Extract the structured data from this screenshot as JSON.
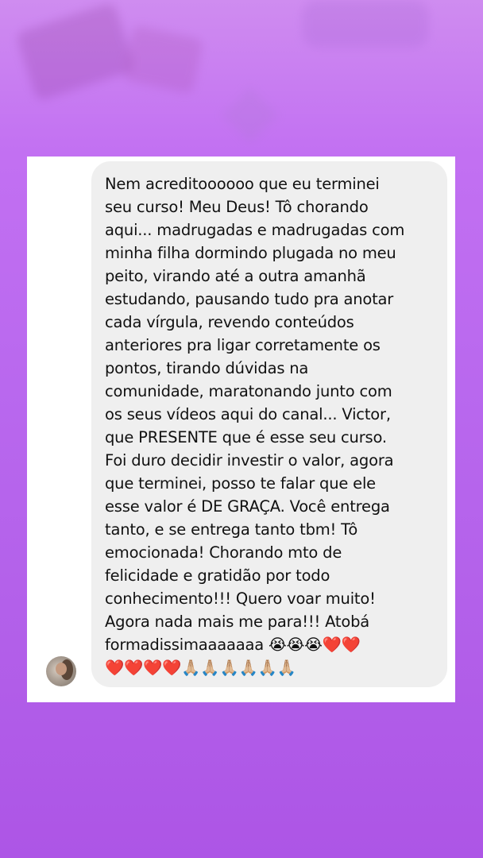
{
  "chat": {
    "message_text": "Nem acreditoooooo que eu terminei\nseu curso! Meu Deus! Tô chorando\naqui... madrugadas e madrugadas com\nminha filha dormindo plugada no meu\npeito, virando até a outra amanhã\nestudando, pausando tudo pra anotar\ncada vírgula, revendo conteúdos\nanteriores pra ligar corretamente os\npontos, tirando dúvidas na\ncomunidade, maratonando junto com\nos seus vídeos aqui do canal... Victor,\nque PRESENTE que é esse seu curso.\nFoi duro decidir investir o valor, agora\nque terminei, posso te falar que ele\nesse valor é DE GRAÇA. Você entrega\ntanto, e se entrega tanto tbm! Tô\nemocionada! Chorando mto de\nfelicidade e gratidão por todo\nconhecimento!!! Quero voar muito!\nAgora nada mais me para!!! Atobá\nformadissimaaaaaaa 😭😭😭❤️❤️\n❤️❤️❤️❤️🙏🏼🙏🏼🙏🏼🙏🏼🙏🏼🙏🏼",
    "bubble_color": "#efefef",
    "card_color": "#ffffff"
  },
  "colors": {
    "background_top": "#cf8cf0",
    "background_bottom": "#ad55e6"
  }
}
